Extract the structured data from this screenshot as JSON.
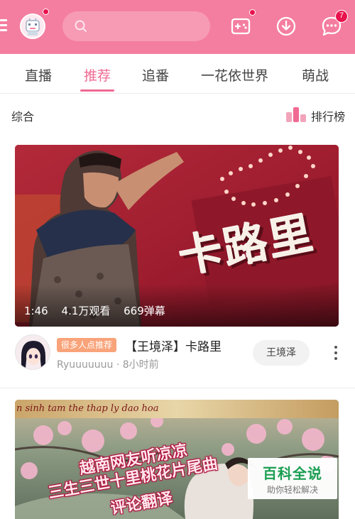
{
  "header": {
    "search": {
      "placeholder": ""
    },
    "notification_count": "7",
    "colors": {
      "brand_pink": "#f47ea0",
      "badge_red": "#e8124c"
    },
    "icons": [
      "menu-icon",
      "avatar",
      "search-icon",
      "game-controller-icon",
      "download-icon",
      "message-icon"
    ]
  },
  "tabs": {
    "items": [
      {
        "label": "直播"
      },
      {
        "label": "推荐"
      },
      {
        "label": "追番"
      },
      {
        "label": "一花依世界"
      },
      {
        "label": "萌战"
      }
    ],
    "active": "推荐",
    "active_color": "#f06a93"
  },
  "section": {
    "title": "综合",
    "rank_label": "排行榜"
  },
  "cards": [
    {
      "thumbnail_text": "卡路里",
      "duration": "1:46",
      "views": "4.1万观看",
      "danmaku": "669弹幕",
      "tag": "很多人点推荐",
      "title": "【王境泽】卡路里",
      "uploader": "Ryuuuuuuu",
      "time_ago": "8小时前",
      "meta_separator": "·",
      "follow_label": "王境泽"
    },
    {
      "thumbnail_caption": "n sinh tam the thap ly dao hoa",
      "overlay_lines": [
        "越南网友听凉凉",
        "三生三世十里桃花片尾曲",
        "评论翻译"
      ]
    }
  ],
  "watermark": {
    "title": "百科全说",
    "subtitle": "助你轻松解决",
    "color": "#1a9e52"
  }
}
